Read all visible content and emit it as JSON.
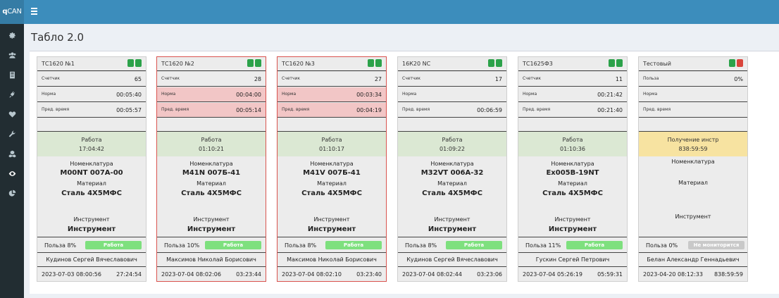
{
  "app": {
    "brand_prefix": "q",
    "brand_suffix": "CAN"
  },
  "page": {
    "title": "Табло 2.0"
  },
  "sidebar": {
    "items": [
      {
        "icon": "gear-icon"
      },
      {
        "icon": "users-icon"
      },
      {
        "icon": "book-icon"
      },
      {
        "icon": "plug-icon"
      },
      {
        "icon": "heartbeat-icon"
      },
      {
        "icon": "wrench-icon"
      },
      {
        "icon": "cubes-icon"
      },
      {
        "icon": "eye-icon",
        "active": true
      },
      {
        "icon": "pie-chart-icon"
      }
    ]
  },
  "colors": {
    "topbar": "#3c8dbc",
    "sidebar": "#222d32",
    "led_green": "#2ca24a",
    "led_red": "#d9443a",
    "work_green": "#dbe8d3",
    "alert_pink": "#f2c6c6",
    "alert_border": "#d9534f",
    "waiting_yellow": "#f7e3a1",
    "badge_green": "#7ee07e",
    "badge_grey": "#c9c9c9"
  },
  "labels": {
    "counter": "Счетчик",
    "norm": "Норма",
    "pred": "Пред. время",
    "nomenclature": "Номенклатура",
    "material": "Материал",
    "tool": "Инструмент",
    "use": "Польза"
  },
  "machines": [
    {
      "name": "ТС1620 №1",
      "leds": [
        "green",
        "green"
      ],
      "alert": false,
      "row1_label": "Счетчик",
      "row1_value": "65",
      "row2_value": "00:05:40",
      "row3_value": "00:05:57",
      "state": "Работа",
      "state_time": "17:04:42",
      "nomenclature": "M00NT 007A-00",
      "material": "Сталь 4Х5МФС",
      "tool": "Инструмент",
      "use_pct": "Польза 8%",
      "badge": "Работа",
      "operator": "Кудинов Сергей Вячеславович",
      "date": "2023-07-03 08:00:56",
      "duration": "27:24:54"
    },
    {
      "name": "ТС1620 №2",
      "leds": [
        "green",
        "green"
      ],
      "alert": true,
      "row1_label": "Счетчик",
      "row1_value": "28",
      "row2_value": "00:04:00",
      "row3_value": "00:05:14",
      "state": "Работа",
      "state_time": "01:10:21",
      "nomenclature": "M41N 007Б-41",
      "material": "Сталь 4Х5МФС",
      "tool": "Инструмент",
      "use_pct": "Польза 10%",
      "badge": "Работа",
      "operator": "Максимов Николай Борисович",
      "date": "2023-07-04 08:02:06",
      "duration": "03:23:44"
    },
    {
      "name": "ТС1620 №3",
      "leds": [
        "green",
        "green"
      ],
      "alert": true,
      "row1_label": "Счетчик",
      "row1_value": "27",
      "row2_value": "00:03:34",
      "row3_value": "00:04:19",
      "state": "Работа",
      "state_time": "01:10:17",
      "nomenclature": "M41V 007Б-41",
      "material": "Сталь 4Х5МФС",
      "tool": "Инструмент",
      "use_pct": "Польза 8%",
      "badge": "Работа",
      "operator": "Максимов Николай Борисович",
      "date": "2023-07-04 08:02:10",
      "duration": "03:23:40"
    },
    {
      "name": "16К20 NC",
      "leds": [
        "green",
        "green"
      ],
      "alert": false,
      "row1_label": "Счетчик",
      "row1_value": "17",
      "row2_value": "",
      "row3_value": "00:06:59",
      "state": "Работа",
      "state_time": "01:09:22",
      "nomenclature": "M32VT 006A-32",
      "material": "Сталь 4Х5МФС",
      "tool": "Инструмент",
      "use_pct": "Польза 8%",
      "badge": "Работа",
      "operator": "Кудинов Сергей Вячеславович",
      "date": "2023-07-04 08:02:44",
      "duration": "03:23:06"
    },
    {
      "name": "ТС1625Ф3",
      "leds": [
        "green",
        "green"
      ],
      "alert": false,
      "row1_label": "Счетчик",
      "row1_value": "11",
      "row2_value": "00:21:42",
      "row3_value": "00:21:40",
      "state": "Работа",
      "state_time": "01:10:36",
      "nomenclature": "Ex005B-19NT",
      "material": "Сталь 4Х5МФС",
      "tool": "Инструмент",
      "use_pct": "Польза 11%",
      "badge": "Работа",
      "operator": "Гускин Сергей Петрович",
      "date": "2023-07-04 05:26:19",
      "duration": "05:59:31"
    },
    {
      "name": "Тестовый",
      "leds": [
        "green",
        "red"
      ],
      "alert": false,
      "row1_label": "Польза",
      "row1_value": "0%",
      "row2_value": "",
      "row3_value": "",
      "state": "Получение инстр",
      "state_time": "838:59:59",
      "nomenclature": "",
      "material": "",
      "tool": "",
      "use_pct": "Польза 0%",
      "badge": "Не мониторится",
      "operator": "Белан Александр Геннадьевич",
      "date": "2023-04-20 08:12:33",
      "duration": "838:59:59"
    }
  ]
}
